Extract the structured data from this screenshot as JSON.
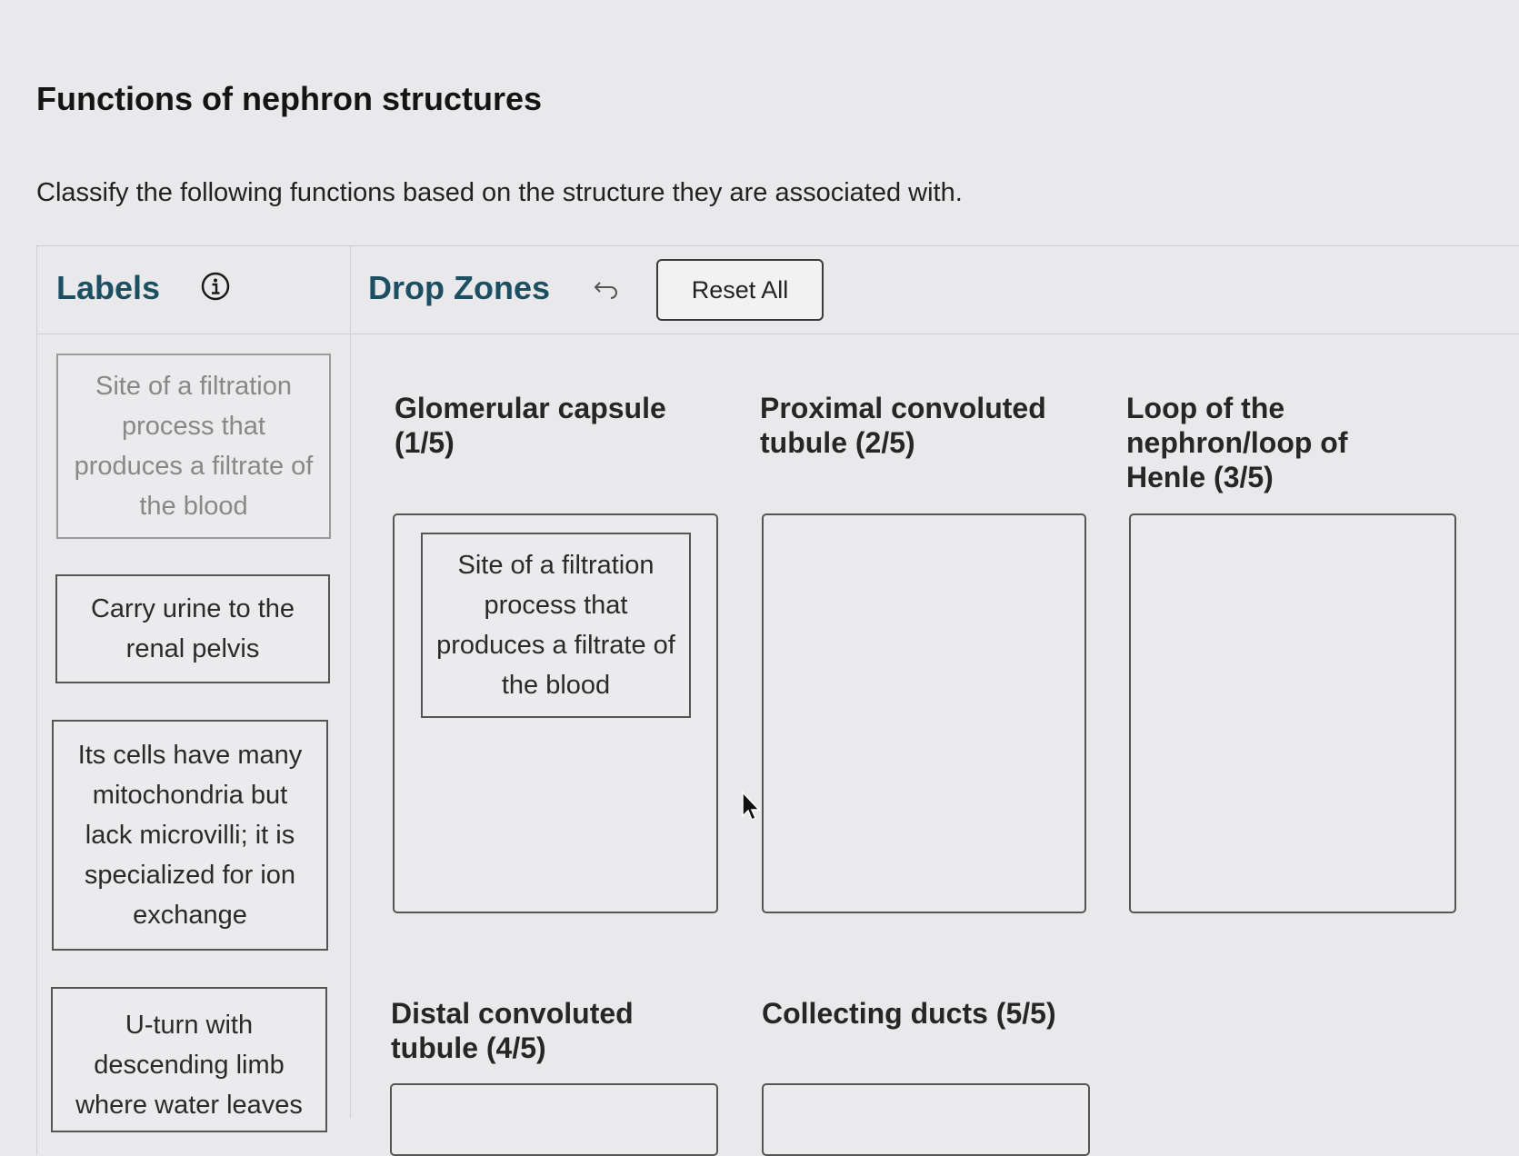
{
  "header": {
    "title": "Functions of nephron structures",
    "instructions": "Classify the following functions based on the structure they are associated with."
  },
  "labels_panel": {
    "heading": "Labels",
    "info_icon": "info-circle-icon",
    "cards": [
      {
        "text": "Site of a filtration process that produces a filtrate of the blood",
        "state": "used"
      },
      {
        "text": "Carry urine to the renal pelvis",
        "state": "available"
      },
      {
        "text": "Its cells have many mitochondria but lack microvilli; it is specialized for ion exchange",
        "state": "available"
      },
      {
        "text": "U-turn with descending limb where water leaves",
        "state": "available"
      }
    ]
  },
  "drop_zones_panel": {
    "heading": "Drop Zones",
    "undo_icon": "undo-arrow-icon",
    "reset_label": "Reset All",
    "zones": [
      {
        "title": "Glomerular capsule (1/5)",
        "placed": [
          "Site of a filtration process that produces a filtrate of the blood"
        ]
      },
      {
        "title": "Proximal convoluted tubule (2/5)",
        "placed": []
      },
      {
        "title": "Loop of the nephron/loop of Henle (3/5)",
        "placed": []
      },
      {
        "title": "Distal convoluted tubule (4/5)",
        "placed": []
      },
      {
        "title": "Collecting ducts (5/5)",
        "placed": []
      }
    ]
  },
  "colors": {
    "heading": "#1d4f62",
    "background": "#e9e9eb",
    "border": "#555555"
  }
}
